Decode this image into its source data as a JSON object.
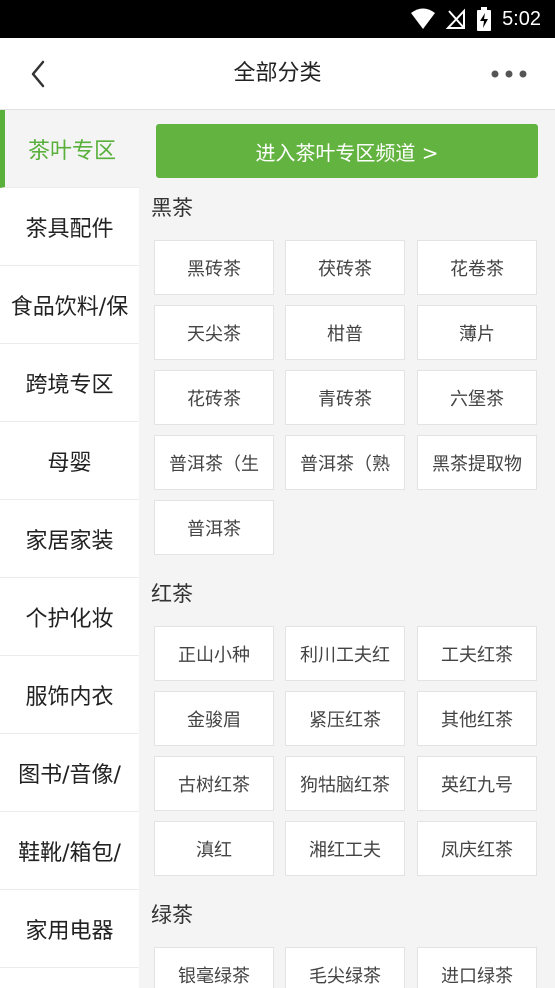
{
  "status": {
    "time": "5:02",
    "icons": [
      "wifi-icon",
      "no-signal-icon",
      "battery-charging-icon"
    ]
  },
  "header": {
    "title": "全部分类",
    "back_icon": "chevron-left-icon",
    "more_icon": "more-dots-icon"
  },
  "sidebar": {
    "items": [
      {
        "label": "茶叶专区",
        "active": true
      },
      {
        "label": "茶具配件"
      },
      {
        "label": "食品饮料/保"
      },
      {
        "label": "跨境专区"
      },
      {
        "label": "母婴"
      },
      {
        "label": "家居家装"
      },
      {
        "label": "个护化妆"
      },
      {
        "label": "服饰内衣"
      },
      {
        "label": "图书/音像/"
      },
      {
        "label": "鞋靴/箱包/"
      },
      {
        "label": "家用电器"
      }
    ]
  },
  "main": {
    "channel_button": "进入茶叶专区频道 >",
    "sections": [
      {
        "title": "黑茶",
        "items": [
          "黑砖茶",
          "茯砖茶",
          "花卷茶",
          "天尖茶",
          "柑普",
          "薄片",
          "花砖茶",
          "青砖茶",
          "六堡茶",
          "普洱茶（生",
          "普洱茶（熟",
          "黑茶提取物",
          "普洱茶"
        ]
      },
      {
        "title": "红茶",
        "items": [
          "正山小种",
          "利川工夫红",
          "工夫红茶",
          "金骏眉",
          "紧压红茶",
          "其他红茶",
          "古树红茶",
          "狗牯脑红茶",
          "英红九号",
          "滇红",
          "湘红工夫",
          "凤庆红茶"
        ]
      },
      {
        "title": "绿茶",
        "items": [
          "银毫绿茶",
          "毛尖绿茶",
          "进口绿茶"
        ]
      }
    ]
  },
  "colors": {
    "accent": "#59b03b",
    "button": "#62b33f",
    "status_bar": "#000000"
  }
}
